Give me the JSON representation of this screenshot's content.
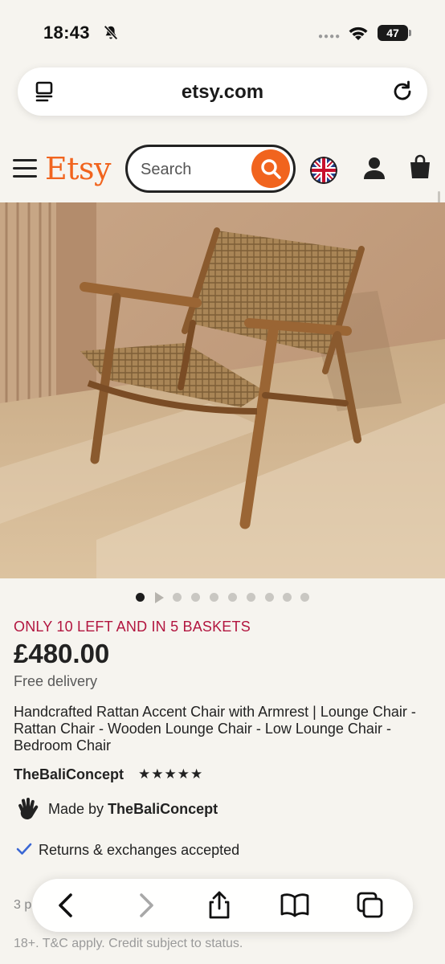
{
  "status_bar": {
    "time": "18:43",
    "battery": "47"
  },
  "browser": {
    "url": "etsy.com"
  },
  "header": {
    "logo": "Etsy",
    "search_placeholder": "Search"
  },
  "product": {
    "carousel": {
      "total": 9,
      "active_index": 0
    },
    "stock_notice": "ONLY 10 LEFT AND IN 5 BASKETS",
    "price": "£480.00",
    "delivery": "Free delivery",
    "title": "Handcrafted Rattan Accent Chair with Armrest | Lounge Chair - Rattan Chair - Wooden Lounge Chair - Low Lounge Chair - Bedroom Chair",
    "shop_name": "TheBaliConcept",
    "rating_stars": "★★★★★",
    "made_by_prefix": "Made by",
    "made_by_shop": "TheBaliConcept",
    "returns": "Returns & exchanges accepted",
    "payment_partial": "3 p",
    "terms": "18+. T&C apply. Credit subject to status."
  },
  "colors": {
    "accent": "#f1641e",
    "stock_red": "#b2153f",
    "check_blue": "#3b67d4"
  }
}
